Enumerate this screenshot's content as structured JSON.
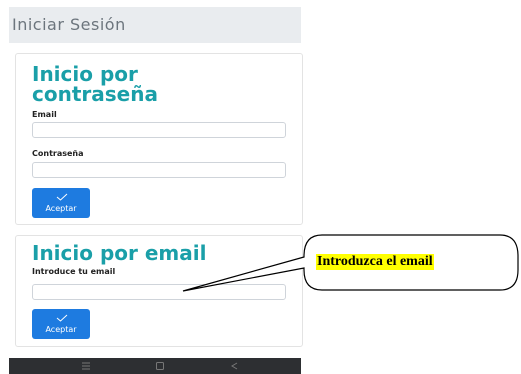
{
  "header": {
    "title": "Iniciar Sesión"
  },
  "password_login": {
    "title": "Inicio por contraseña",
    "email_label": "Email",
    "email_value": "",
    "password_label": "Contraseña",
    "password_value": "",
    "submit_label": "Aceptar"
  },
  "email_login": {
    "title": "Inicio por email",
    "email_label": "Introduce tu email",
    "email_value": "",
    "submit_label": "Aceptar"
  },
  "nav_bar": {
    "icons": [
      "menu-icon",
      "home-icon",
      "back-icon"
    ],
    "color": "#2d2f32"
  },
  "annotation": {
    "text": "Introduzca el email",
    "highlight_color": "#ffff00"
  },
  "colors": {
    "accent_title": "#1a9fa8",
    "button": "#1e7be0",
    "header_bg": "#e9ecef"
  }
}
